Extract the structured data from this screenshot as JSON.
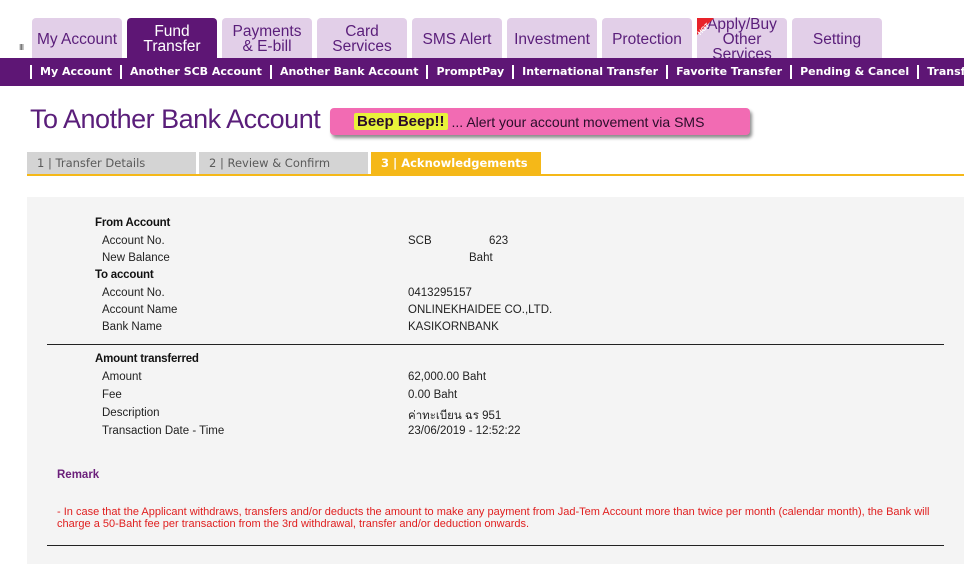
{
  "tabs": [
    {
      "label": "My Account"
    },
    {
      "label": "Fund\nTransfer"
    },
    {
      "label": "Payments\n& E-bill"
    },
    {
      "label": "Card\nServices"
    },
    {
      "label": "SMS Alert"
    },
    {
      "label": "Investment"
    },
    {
      "label": "Protection"
    },
    {
      "label": "Apply/Buy\nOther Services",
      "badge": "HOT"
    },
    {
      "label": "Setting"
    }
  ],
  "subnav": [
    "My Account",
    "Another SCB Account",
    "Another Bank Account",
    "PromptPay",
    "International Transfer",
    "Favorite Transfer",
    "Pending & Cancel",
    "Transfer History"
  ],
  "page": {
    "title": "To Another Bank Account",
    "promo_highlight": "Beep Beep!!",
    "promo_text": "... Alert your account movement via SMS"
  },
  "steps": [
    "1 | Transfer Details",
    "2 | Review & Confirm",
    "3 | Acknowledgements"
  ],
  "from_account": {
    "heading": "From Account",
    "account_no_label": "Account No.",
    "account_no_bank": "SCB",
    "account_no_suffix": "623",
    "new_balance_label": "New Balance",
    "new_balance_unit": "Baht"
  },
  "to_account": {
    "heading": "To account",
    "account_no_label": "Account No.",
    "account_no": "0413295157",
    "account_name_label": "Account Name",
    "account_name": "ONLINEKHAIDEE CO.,LTD.",
    "bank_name_label": "Bank Name",
    "bank_name": "KASIKORNBANK"
  },
  "amount": {
    "heading": "Amount transferred",
    "amount_label": "Amount",
    "amount_value": "62,000.00  Baht",
    "fee_label": "Fee",
    "fee_value": "0.00  Baht",
    "description_label": "Description",
    "description_value": "ค่าทะเบียน ฉร 951",
    "datetime_label": "Transaction Date - Time",
    "datetime_value": "23/06/2019 - 12:52:22"
  },
  "remark": {
    "title": "Remark",
    "text": "- In case that the Applicant withdraws, transfers and/or deducts the amount to make any payment from Jad-Tem Account more than twice per month (calendar month), the Bank will charge a 50-Baht fee per transaction from the 3rd withdrawal, transfer and/or deduction onwards."
  },
  "colors": {
    "brand_purple": "#5e1675",
    "tab_inactive": "#e2cfe8",
    "step_active": "#f5b818",
    "remark_text": "#e02020"
  }
}
